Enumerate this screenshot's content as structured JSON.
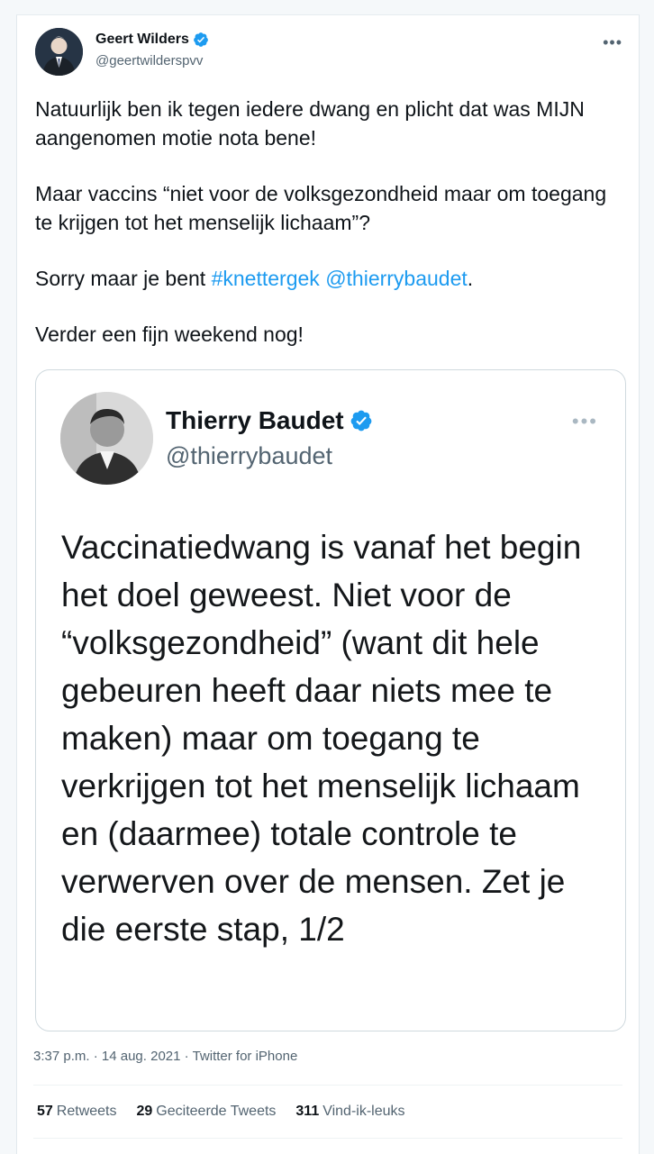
{
  "tweet": {
    "author_name": "Geert Wilders",
    "author_handle": "@geertwilderspvv",
    "more_label": "•••",
    "para1": "Natuurlijk ben ik tegen iedere dwang en plicht dat was MIJN aangenomen motie nota bene!",
    "para2": "Maar vaccins “niet voor de volksgezondheid maar om toegang te krijgen tot het menselijk lichaam”?",
    "para3_prefix": "Sorry maar je bent ",
    "hashtag": "#knettergek",
    "mention": "@thierrybaudet",
    "para3_suffix": ".",
    "para4": "Verder een fijn weekend nog!",
    "time": "3:37 p.m.",
    "sep": "·",
    "date": "14 aug. 2021",
    "source": "Twitter for iPhone"
  },
  "quoted": {
    "author_name": "Thierry Baudet",
    "author_handle": "@thierrybaudet",
    "more_label": "•••",
    "text": "Vaccinatiedwang is vanaf het begin het doel geweest. Niet voor de “volksgezondheid” (want dit hele gebeuren heeft daar niets mee te maken) maar om toegang te verkrijgen tot het menselijk lichaam en (daarmee) totale controle te verwerven over de mensen. Zet je die eerste stap, 1/2"
  },
  "stats": {
    "retweets_count": "57",
    "retweets_label": "Retweets",
    "quotes_count": "29",
    "quotes_label": "Geciteerde Tweets",
    "likes_count": "311",
    "likes_label": "Vind-ik-leuks"
  },
  "colors": {
    "link": "#1d9bf0",
    "verified": "#1d9bf0"
  }
}
